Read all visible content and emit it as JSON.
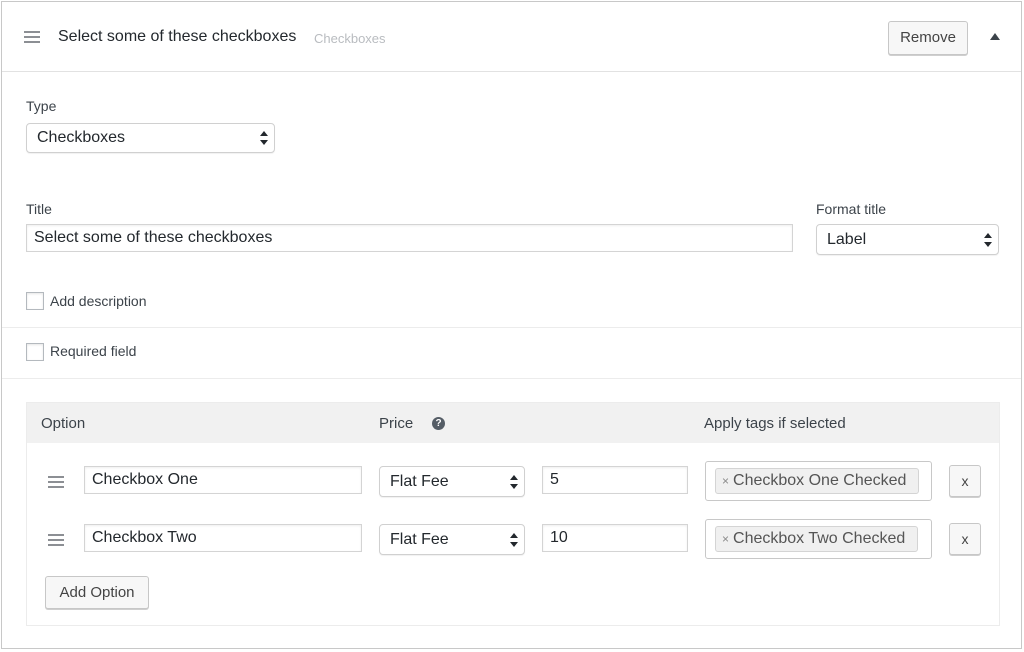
{
  "header": {
    "title": "Select some of these checkboxes",
    "subtitle": "Checkboxes",
    "remove_label": "Remove"
  },
  "type_field": {
    "label": "Type",
    "value": "Checkboxes"
  },
  "title_field": {
    "label": "Title",
    "value": "Select some of these checkboxes"
  },
  "format_title": {
    "label": "Format title",
    "value": "Label"
  },
  "add_description": {
    "label": "Add description",
    "checked": false
  },
  "required_field": {
    "label": "Required field",
    "checked": false
  },
  "options": {
    "headers": {
      "option": "Option",
      "price": "Price",
      "tags": "Apply tags if selected"
    },
    "help_glyph": "?",
    "rows": [
      {
        "option": "Checkbox One",
        "price_type": "Flat Fee",
        "price": "5",
        "tag_remove": "×",
        "tag": "Checkbox One Checked",
        "remove_label": "x"
      },
      {
        "option": "Checkbox Two",
        "price_type": "Flat Fee",
        "price": "10",
        "tag_remove": "×",
        "tag": "Checkbox Two Checked",
        "remove_label": "x"
      }
    ],
    "add_label": "Add Option"
  },
  "icons": {
    "drag": "hamburger-drag-icon",
    "collapse": "triangle-up-icon",
    "help": "question-circle-icon",
    "select": "up-down-arrows-icon"
  },
  "colors": {
    "border": "#c8c8c8",
    "header_bg": "#f1f1f1",
    "text": "#23282d",
    "muted": "#b9bcc0"
  }
}
